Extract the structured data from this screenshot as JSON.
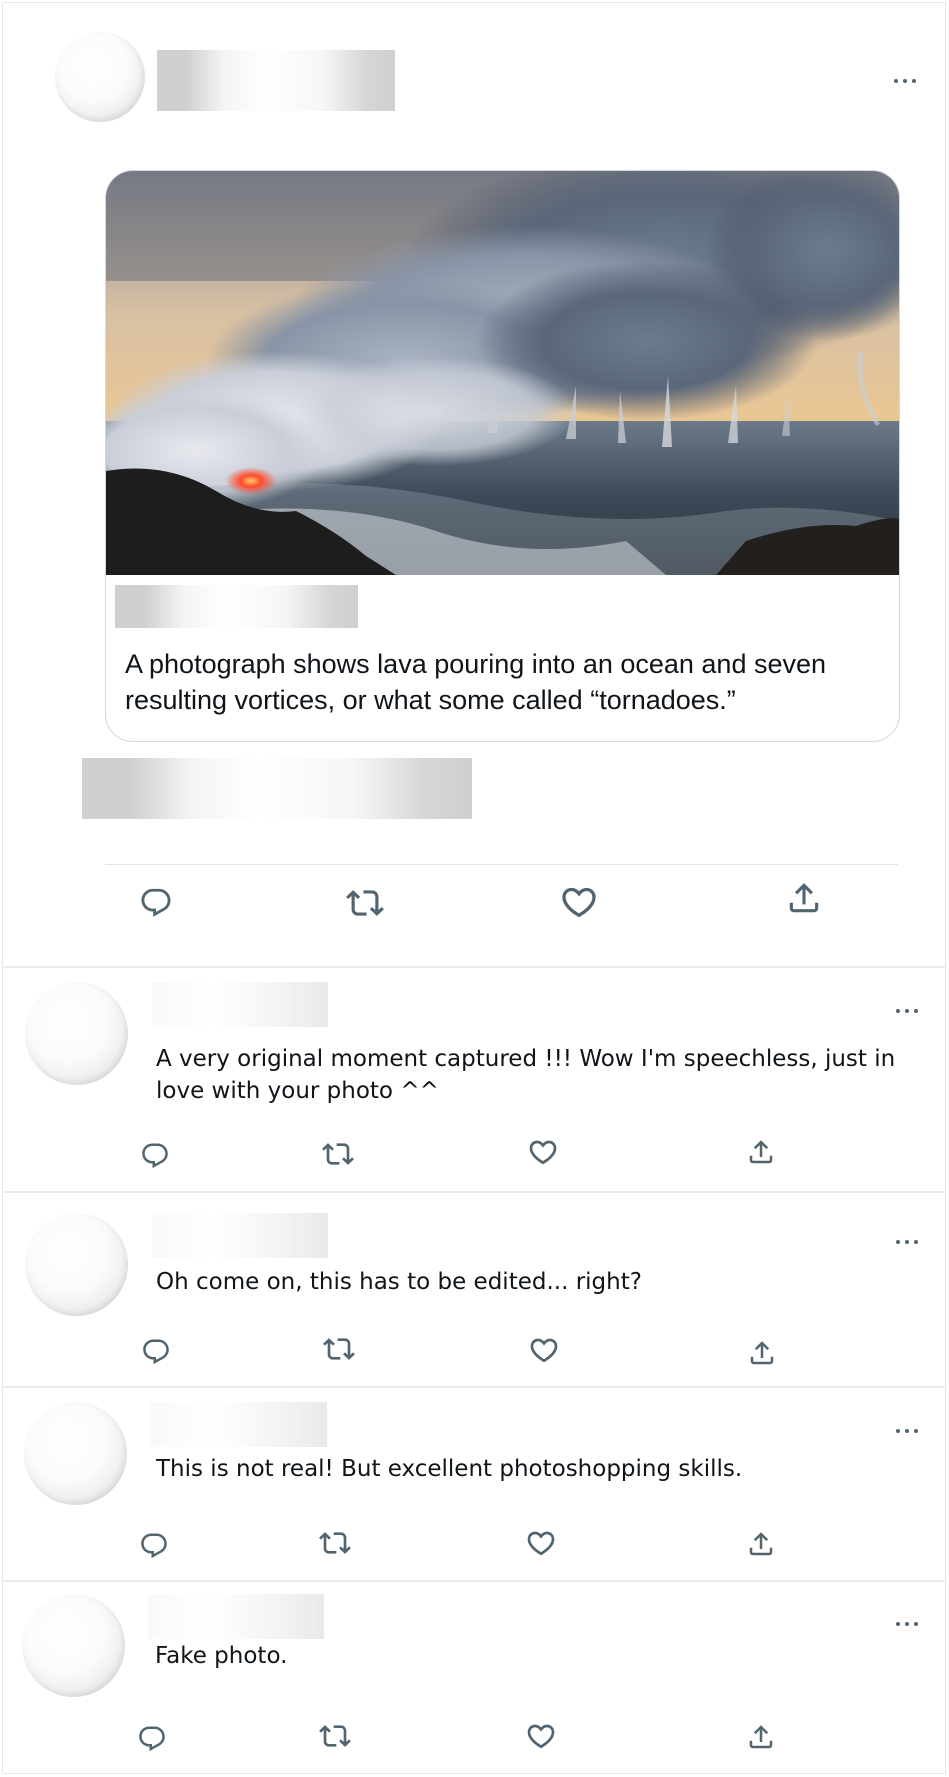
{
  "post": {
    "caption": "A photograph shows lava pouring into an ocean and seven resulting vortices, or what some called “tornadoes.”",
    "icons": [
      "more-icon",
      "reply-icon",
      "retweet-icon",
      "like-icon",
      "share-icon"
    ]
  },
  "replies": [
    {
      "text": "A very original moment captured !!! Wow I'm speechless, just in love with your photo ^^"
    },
    {
      "text": "Oh come on, this has to be edited... right?"
    },
    {
      "text": "This is not real! But excellent photoshopping skills."
    },
    {
      "text": "Fake photo."
    }
  ],
  "colors": {
    "icon": "#536471",
    "border": "#cfd9de",
    "text": "#0f1419",
    "lava": "#ff4a2a"
  }
}
